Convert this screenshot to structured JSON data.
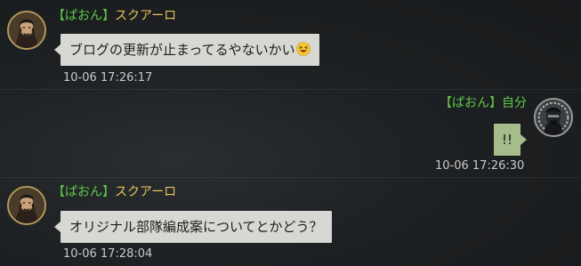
{
  "messages": [
    {
      "bracket_open": "【",
      "group": "ぱおん",
      "bracket_close": "】",
      "sender": "スクアーロ",
      "text": "ブログの更新が止まってるやないかい",
      "emoji": "grinning-squint-face",
      "time": "10-06 17:26:17"
    },
    {
      "bracket_open": "【",
      "group": "ぱおん",
      "bracket_close": "】",
      "sender": "自分",
      "text": "!!",
      "time": "10-06 17:26:30"
    },
    {
      "bracket_open": "【",
      "group": "ぱおん",
      "bracket_close": "】",
      "sender": "スクアーロ",
      "text": "オリジナル部隊編成案についてとかどう？",
      "time": "10-06 17:28:04"
    }
  ],
  "colors": {
    "bracket_group": "#5fc84a",
    "character_name": "#e6c25c",
    "other_bubble": "#d7d7d3",
    "self_bubble": "#a6bc8a",
    "timestamp": "#c9c9c9"
  }
}
